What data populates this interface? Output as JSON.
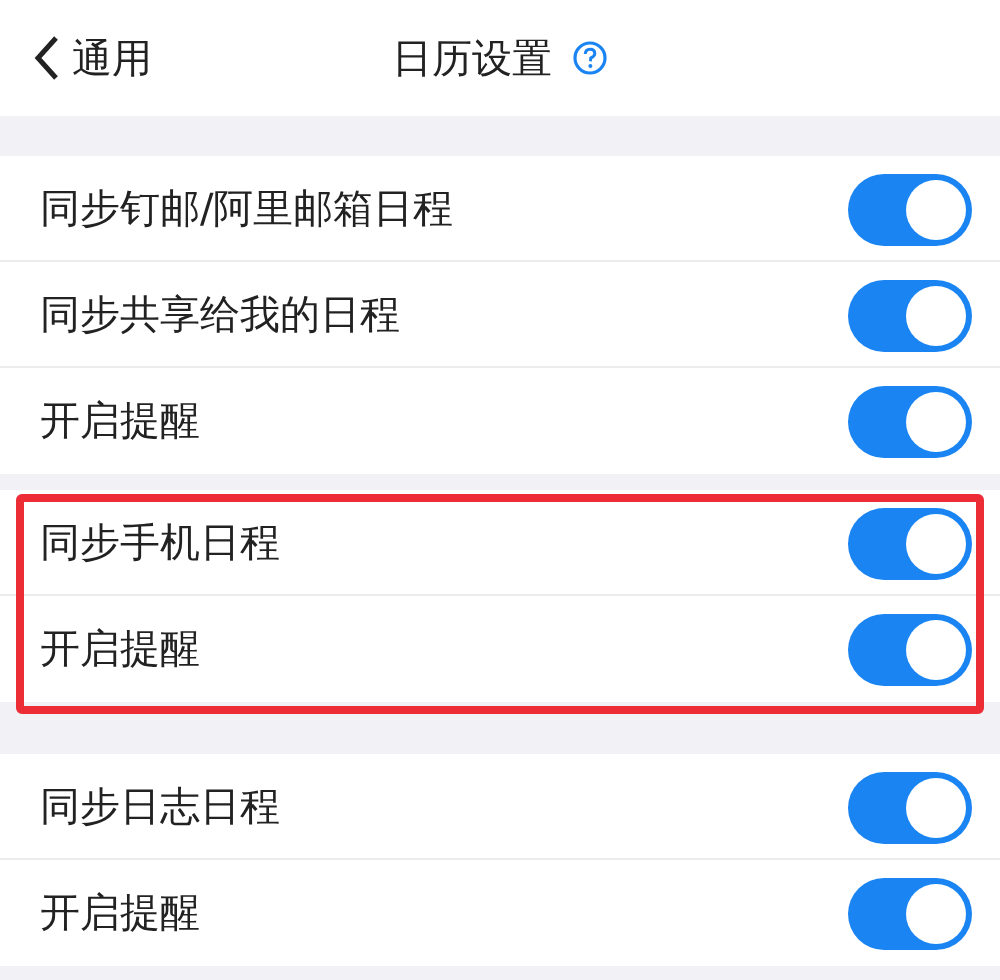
{
  "header": {
    "back_label": "通用",
    "title": "日历设置"
  },
  "groups": [
    {
      "highlighted": false,
      "rows": [
        {
          "label": "同步钉邮/阿里邮箱日程",
          "on": true
        },
        {
          "label": "同步共享给我的日程",
          "on": true
        },
        {
          "label": "开启提醒",
          "on": true
        }
      ]
    },
    {
      "highlighted": true,
      "rows": [
        {
          "label": "同步手机日程",
          "on": true
        },
        {
          "label": "开启提醒",
          "on": true
        }
      ]
    },
    {
      "highlighted": false,
      "rows": [
        {
          "label": "同步日志日程",
          "on": true
        },
        {
          "label": "开启提醒",
          "on": true
        }
      ]
    }
  ]
}
